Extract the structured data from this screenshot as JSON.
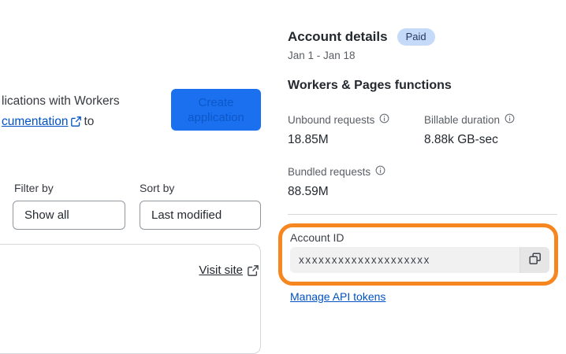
{
  "left_panel": {
    "intro_line1": "lications with Workers",
    "intro_link_text": "cumentation",
    "intro_after_link": "to",
    "create_button_label": "Create application",
    "filter_label": "Filter by",
    "filter_value": "Show all",
    "sort_label": "Sort by",
    "sort_value": "Last modified",
    "visit_site_label": "Visit site"
  },
  "account_panel": {
    "title": "Account details",
    "plan_badge": "Paid",
    "date_range": "Jan 1 - Jan 18",
    "section_title": "Workers & Pages functions",
    "stats": [
      {
        "label": "Unbound requests",
        "value": "18.85M"
      },
      {
        "label": "Billable duration",
        "value": "8.88k GB-sec"
      },
      {
        "label": "Bundled requests",
        "value": "88.59M"
      }
    ],
    "account_id": {
      "label": "Account ID",
      "value": "xxxxxxxxxxxxxxxxxxxx"
    },
    "manage_tokens_label": "Manage API tokens"
  },
  "colors": {
    "highlight_orange": "#f6861f",
    "link_blue": "#0051c3",
    "button_blue": "#1a70ef",
    "badge_blue_bg": "#c5d9f8"
  }
}
